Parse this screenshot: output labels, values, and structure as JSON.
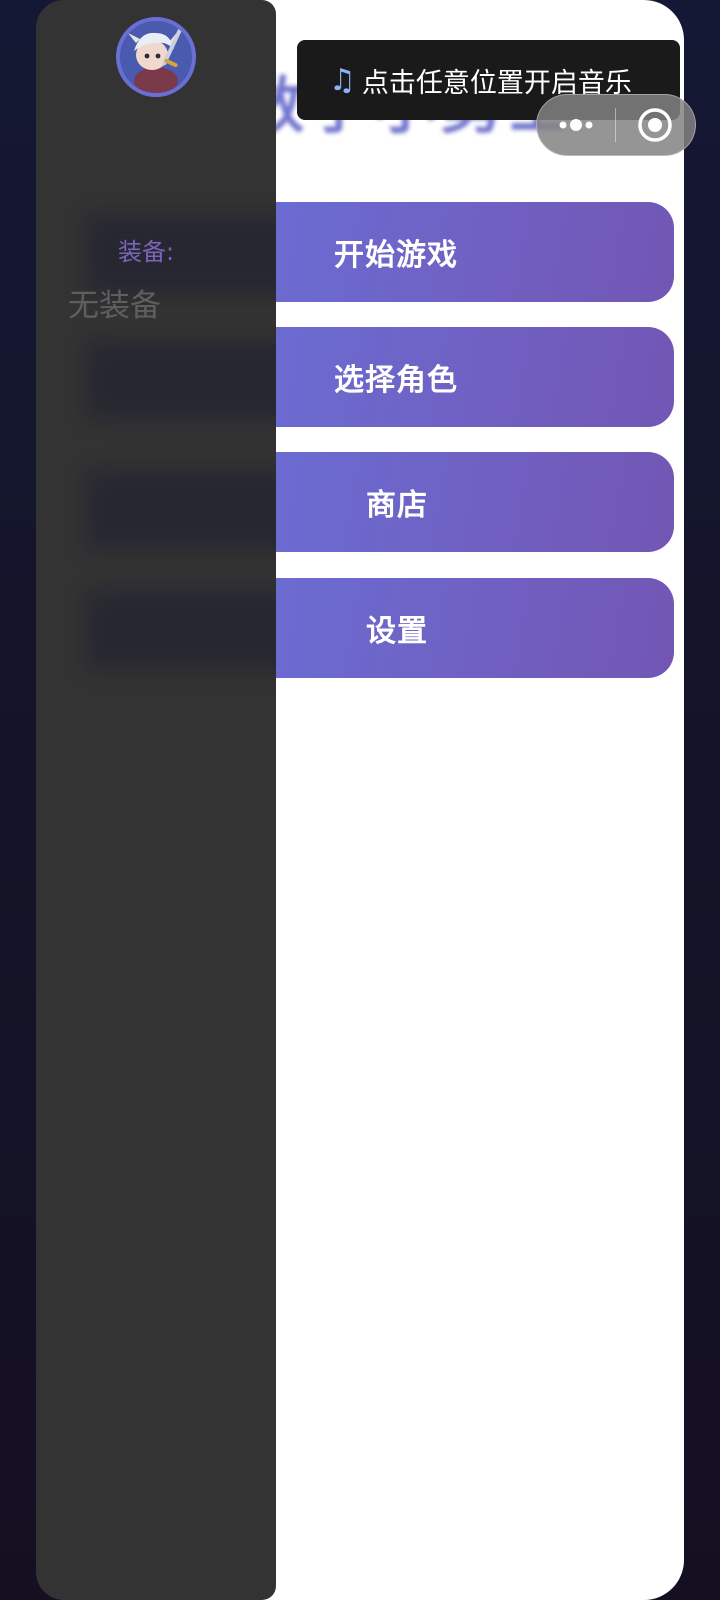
{
  "title": {
    "text": "数学小勇士"
  },
  "menu": {
    "start_game": "开始游戏",
    "select_character": "选择角色",
    "shop": "商店",
    "settings": "设置"
  },
  "toast": {
    "icon": "music-note-icon",
    "message": "点击任意位置开启音乐"
  },
  "capsule": {
    "more_icon": "more-dots-icon",
    "close_icon": "target-close-icon"
  },
  "drawer": {
    "avatar": "hero-avatar",
    "equipment_label": "装备:",
    "equipment_value": "无装备"
  },
  "colors": {
    "accent_start": "#6a6fd6",
    "accent_end": "#7356b4",
    "drawer_bg": "#333333",
    "page_bg": "#151834"
  }
}
